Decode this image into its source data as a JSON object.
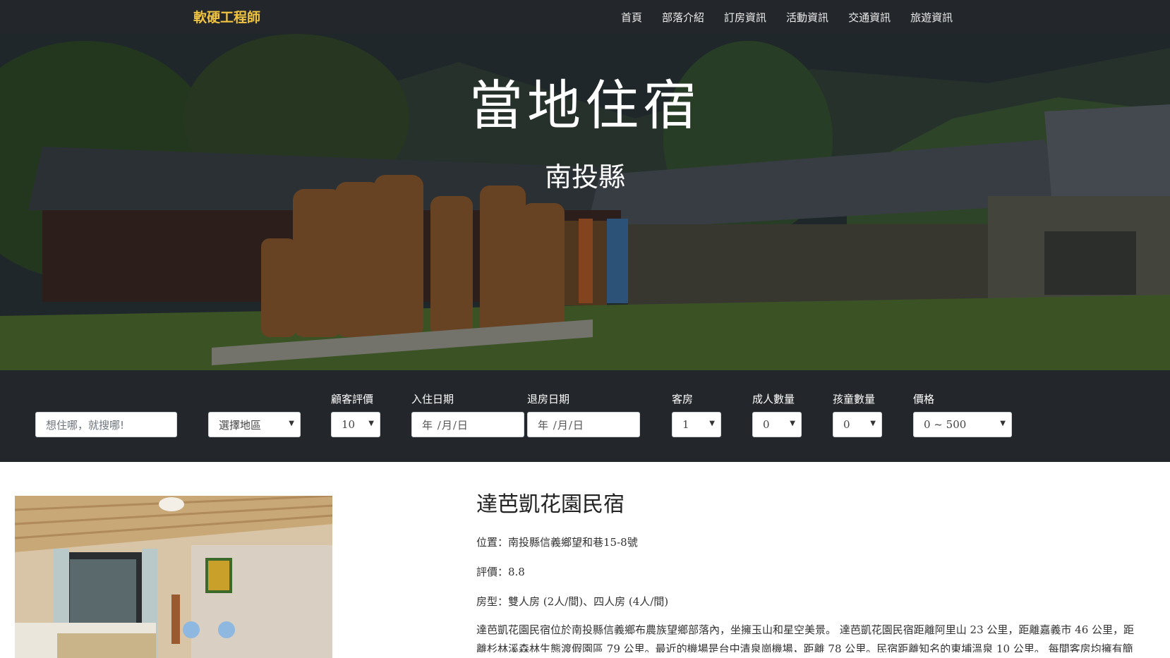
{
  "navbar": {
    "brand": "軟硬工程師",
    "links": [
      "首頁",
      "部落介紹",
      "訂房資訊",
      "活動資訊",
      "交通資訊",
      "旅遊資訊"
    ]
  },
  "hero": {
    "title": "當地住宿",
    "subtitle": "南投縣"
  },
  "search": {
    "keyword_placeholder": "想住哪，就搜哪!",
    "region": {
      "value": "選擇地區"
    },
    "rating": {
      "label": "顧客評價",
      "value": "10"
    },
    "checkin": {
      "label": "入住日期",
      "value": "年 /月/日"
    },
    "checkout": {
      "label": "退房日期",
      "value": "年 /月/日"
    },
    "rooms": {
      "label": "客房",
      "value": "1"
    },
    "adults": {
      "label": "成人數量",
      "value": "0"
    },
    "children": {
      "label": "孩童數量",
      "value": "0"
    },
    "price": {
      "label": "價格",
      "value": "0 ~ 500"
    }
  },
  "listing": {
    "name": "達芭凱花園民宿",
    "location": "位置：南投縣信義鄉望和巷15-8號",
    "rating": "評價：8.8",
    "room_types": "房型：雙人房 (2人/間)、四人房 (4人/間)",
    "description": "達芭凱花園民宿位於南投縣信義鄉布農族望鄉部落內，坐擁玉山和星空美景。 達芭凱花園民宿距離阿里山 23 公里，距離嘉義市 46 公里，距離杉林溪森林生態渡假園區 79 公里。最近的機場是台中清泉崗機場，距離 78 公里。民宿距離知名的東埔溫泉 10 公里。 每間客房均擁有簡單而"
  },
  "colors": {
    "navbar_bg": "#23272b",
    "brand": "#f0c341",
    "searchbar_bg": "#23272b"
  }
}
